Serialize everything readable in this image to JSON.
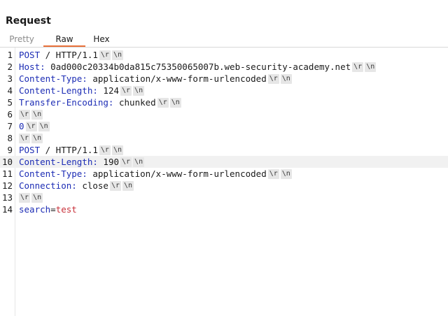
{
  "panel": {
    "title": "Request"
  },
  "tabs": [
    {
      "label": "Pretty"
    },
    {
      "label": "Raw"
    },
    {
      "label": "Hex"
    }
  ],
  "editor": {
    "cr_label": "\\r",
    "lf_label": "\\n",
    "lines": [
      {
        "number": "1",
        "segments": [
          {
            "text": "POST",
            "kind": "kw"
          },
          {
            "text": " / HTTP/1.1",
            "kind": "plain"
          }
        ]
      },
      {
        "number": "2",
        "segments": [
          {
            "text": "Host:",
            "kind": "kw"
          },
          {
            "text": " 0ad000c20334b0da815c75350065007b.web-security-academy.net",
            "kind": "plain"
          }
        ]
      },
      {
        "number": "3",
        "segments": [
          {
            "text": "Content-Type:",
            "kind": "kw"
          },
          {
            "text": " application/x-www-form-urlencoded",
            "kind": "plain"
          }
        ]
      },
      {
        "number": "4",
        "segments": [
          {
            "text": "Content-Length:",
            "kind": "kw"
          },
          {
            "text": " 124",
            "kind": "plain"
          }
        ]
      },
      {
        "number": "5",
        "segments": [
          {
            "text": "Transfer-Encoding:",
            "kind": "kw"
          },
          {
            "text": " chunked",
            "kind": "plain"
          }
        ]
      },
      {
        "number": "6",
        "segments": []
      },
      {
        "number": "7",
        "segments": [
          {
            "text": "0",
            "kind": "kw"
          }
        ]
      },
      {
        "number": "8",
        "segments": []
      },
      {
        "number": "9",
        "segments": [
          {
            "text": "POST",
            "kind": "kw"
          },
          {
            "text": " / HTTP/1.1",
            "kind": "plain"
          }
        ]
      },
      {
        "number": "10",
        "segments": [
          {
            "text": "Content-Length:",
            "kind": "kw"
          },
          {
            "text": " 190",
            "kind": "plain"
          }
        ],
        "highlighted": true
      },
      {
        "number": "11",
        "segments": [
          {
            "text": "Content-Type:",
            "kind": "kw"
          },
          {
            "text": " application/x-www-form-urlencoded",
            "kind": "plain"
          }
        ]
      },
      {
        "number": "12",
        "segments": [
          {
            "text": "Connection:",
            "kind": "kw"
          },
          {
            "text": " close",
            "kind": "plain"
          }
        ]
      },
      {
        "number": "13",
        "segments": []
      },
      {
        "number": "14",
        "segments": [
          {
            "text": "search",
            "kind": "kw"
          },
          {
            "text": "=",
            "kind": "plain"
          },
          {
            "text": "test",
            "kind": "param"
          }
        ],
        "no_crlf": true
      }
    ]
  }
}
